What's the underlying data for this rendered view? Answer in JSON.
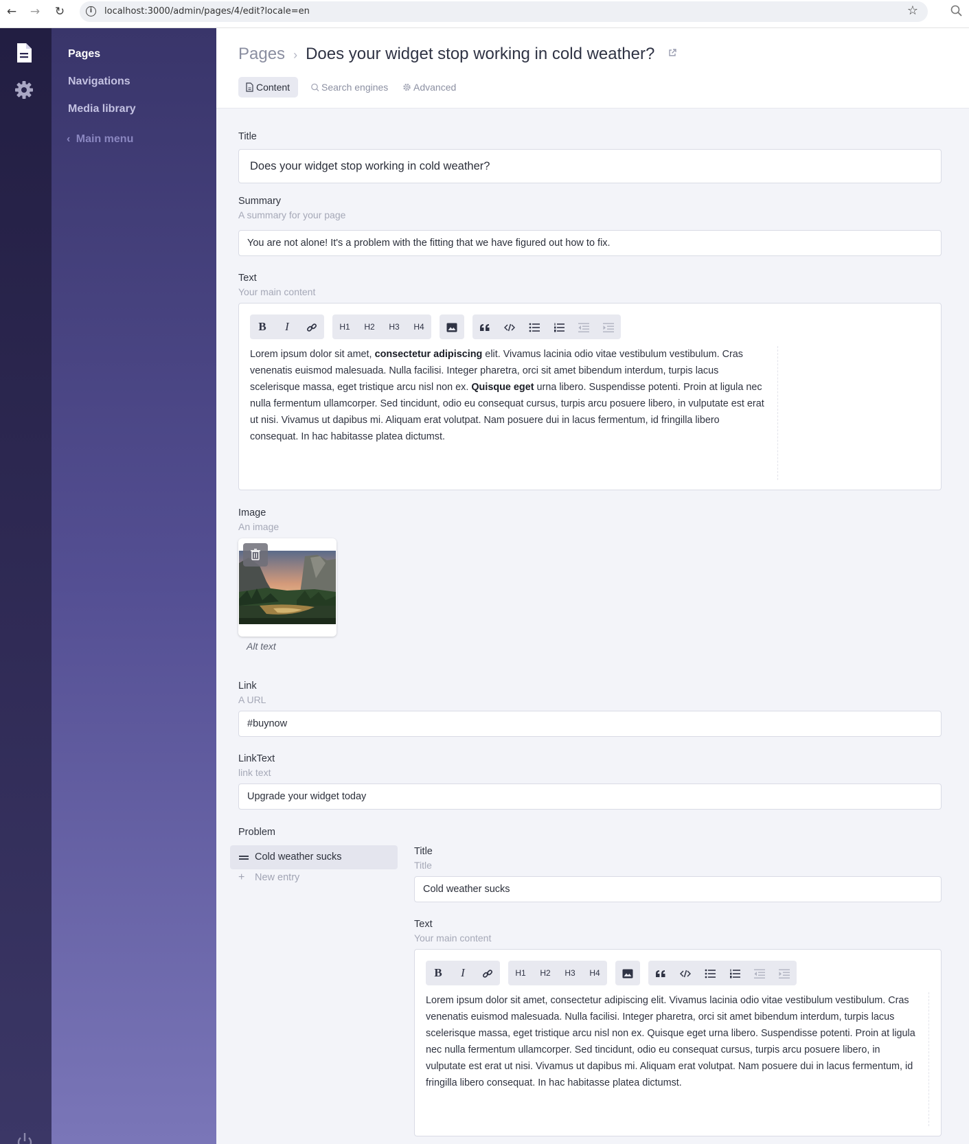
{
  "browser": {
    "url": "localhost:3000/admin/pages/4/edit?locale=en"
  },
  "rail": {
    "icons": [
      "pages-icon",
      "settings-gear-icon",
      "power-icon"
    ]
  },
  "sidebar": {
    "items": [
      {
        "label": "Pages",
        "active": true
      },
      {
        "label": "Navigations",
        "active": false
      },
      {
        "label": "Media library",
        "active": false
      }
    ],
    "back_label": "Main menu"
  },
  "header": {
    "breadcrumb_root": "Pages",
    "page_title": "Does your widget stop working in cold weather?",
    "tabs": [
      {
        "label": "Content",
        "icon": "document-icon",
        "active": true
      },
      {
        "label": "Search engines",
        "icon": "search-icon",
        "active": false
      },
      {
        "label": "Advanced",
        "icon": "gear-icon",
        "active": false
      }
    ]
  },
  "form": {
    "title": {
      "label": "Title",
      "value": "Does your widget stop working in cold weather?"
    },
    "summary": {
      "label": "Summary",
      "hint": "A summary for your page",
      "value": "You are not alone! It's a problem with the fitting that we have figured out how to fix."
    },
    "text": {
      "label": "Text",
      "hint": "Your main content",
      "segments": [
        {
          "t": "Lorem ipsum dolor sit amet, ",
          "bold": false
        },
        {
          "t": "consectetur adipiscing",
          "bold": true
        },
        {
          "t": " elit. Vivamus lacinia odio vitae vestibulum vestibulum. Cras venenatis euismod malesuada. Nulla facilisi. Integer pharetra, orci sit amet bibendum interdum, turpis lacus scelerisque massa, eget tristique arcu nisl non ex. ",
          "bold": false
        },
        {
          "t": "Quisque eget",
          "bold": true
        },
        {
          "t": " urna libero. Suspendisse potenti. Proin at ligula nec nulla fermentum ullamcorper. Sed tincidunt, odio eu consequat cursus, turpis arcu posuere libero, in vulputate est erat ut nisi. Vivamus ut dapibus mi. Aliquam erat volutpat. Nam posuere dui in lacus fermentum, id fringilla libero consequat. In hac habitasse platea dictumst.",
          "bold": false
        }
      ]
    },
    "image": {
      "label": "Image",
      "hint": "An image",
      "alt_placeholder": "Alt text"
    },
    "link": {
      "label": "Link",
      "hint": "A URL",
      "value": "#buynow"
    },
    "link_text": {
      "label": "LinkText",
      "hint": "link text",
      "value": "Upgrade your widget today"
    },
    "problem": {
      "label": "Problem",
      "entries": [
        "Cold weather sucks"
      ],
      "new_entry_label": "New entry",
      "title": {
        "label": "Title",
        "hint": "Title",
        "value": "Cold weather sucks"
      },
      "text": {
        "label": "Text",
        "hint": "Your main content",
        "value": "Lorem ipsum dolor sit amet, consectetur adipiscing elit. Vivamus lacinia odio vitae vestibulum vestibulum. Cras venenatis euismod malesuada. Nulla facilisi. Integer pharetra, orci sit amet bibendum interdum, turpis lacus scelerisque massa, eget tristique arcu nisl non ex. Quisque eget urna libero. Suspendisse potenti. Proin at ligula nec nulla fermentum ullamcorper. Sed tincidunt, odio eu consequat cursus, turpis arcu posuere libero, in vulputate est erat ut nisi. Vivamus ut dapibus mi. Aliquam erat volutpat. Nam posuere dui in lacus fermentum, id fringilla libero consequat. In hac habitasse platea dictumst."
      }
    }
  },
  "toolbar": {
    "buttons": [
      "bold",
      "italic",
      "link",
      "H1",
      "H2",
      "H3",
      "H4",
      "image",
      "quote",
      "code",
      "bullet-list",
      "ordered-list",
      "outdent",
      "indent"
    ],
    "b_label": "B",
    "i_label": "I",
    "h1": "H1",
    "h2": "H2",
    "h3": "H3",
    "h4": "H4"
  },
  "colors": {
    "rail_dark": "#221e42",
    "sidebar_top": "#39356a",
    "sidebar_bottom": "#7a76b8",
    "content_bg": "#f3f4f9"
  }
}
